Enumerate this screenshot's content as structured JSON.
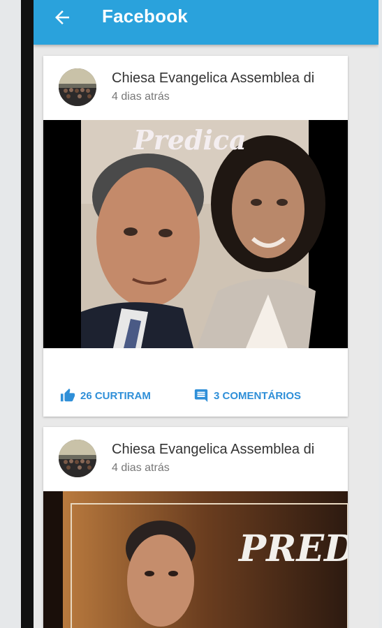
{
  "appbar": {
    "title": "Facebook",
    "color": "#2aa2dc",
    "back_icon": "arrow-back-icon"
  },
  "posts": [
    {
      "author": "Chiesa Evangelica Assemblea di",
      "time": "4 dias atrás",
      "image_text": "Predica",
      "likes_label": "26 CURTIRAM",
      "comments_label": "3 COMENTÁRIOS"
    },
    {
      "author": "Chiesa Evangelica Assemblea di",
      "time": "4 dias atrás",
      "image_text": "PREDIC"
    }
  ],
  "colors": {
    "action": "#2f8fd8"
  }
}
